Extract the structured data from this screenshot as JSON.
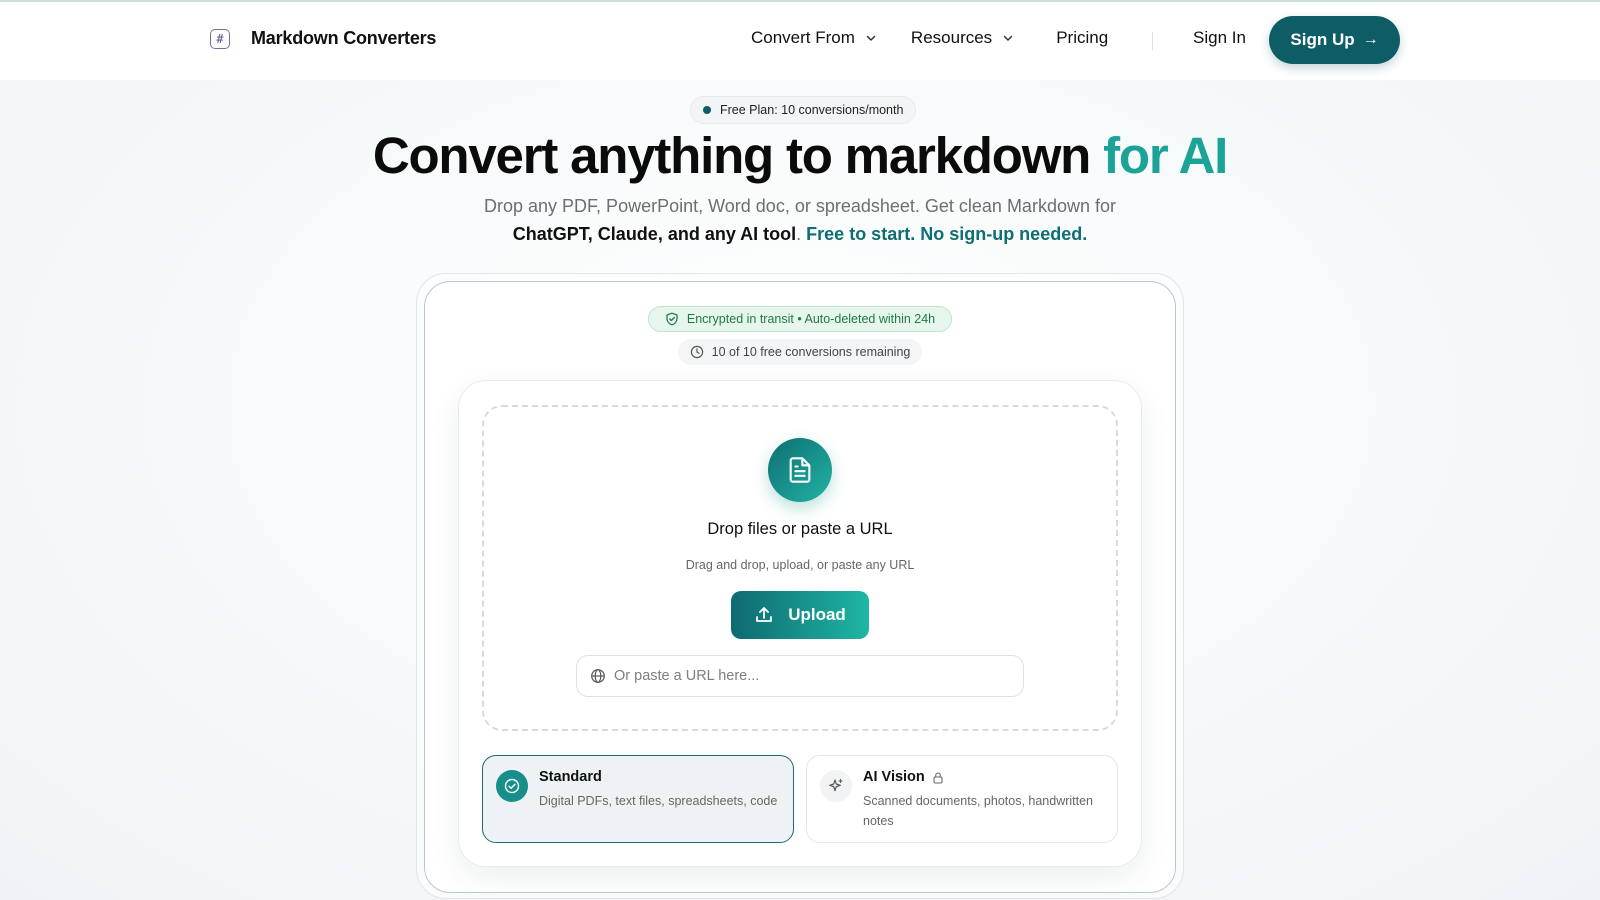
{
  "nav": {
    "brand_icon": "#",
    "brand_name": "Markdown Converters",
    "links": [
      {
        "label": "Convert From",
        "has_dropdown": true
      },
      {
        "label": "Resources",
        "has_dropdown": true
      },
      {
        "label": "Pricing",
        "has_dropdown": false
      }
    ],
    "sign_in": "Sign In",
    "sign_up": "Sign Up",
    "sign_up_arrow": "→"
  },
  "hero": {
    "plan_pill": "Free Plan: 10 conversions/month",
    "title_main": "Convert anything to markdown ",
    "title_accent": "for AI",
    "subtitle_line1": "Drop any PDF, PowerPoint, Word doc, or spreadsheet. Get clean Markdown for",
    "subtitle_bold": "ChatGPT, Claude, and any AI tool",
    "subtitle_sep": ". ",
    "subtitle_teal": "Free to start. No sign-up needed."
  },
  "card": {
    "secure_badge": "Encrypted in transit • Auto-deleted within 24h",
    "remaining": "10 of 10 free conversions remaining",
    "drop_title": "Drop files or paste a URL",
    "drop_subtitle": "Drag and drop, upload, or paste any URL",
    "upload_label": "Upload",
    "url_placeholder": "Or paste a URL here...",
    "modes": [
      {
        "title": "Standard",
        "description": "Digital PDFs, text files, spreadsheets, code",
        "selected": true,
        "locked": false
      },
      {
        "title": "AI Vision",
        "description": "Scanned documents, photos, handwritten notes",
        "selected": false,
        "locked": true
      }
    ]
  },
  "colors": {
    "primary": "#0e5c66",
    "accent": "#1aa396",
    "secure_green": "#1f7a45"
  }
}
